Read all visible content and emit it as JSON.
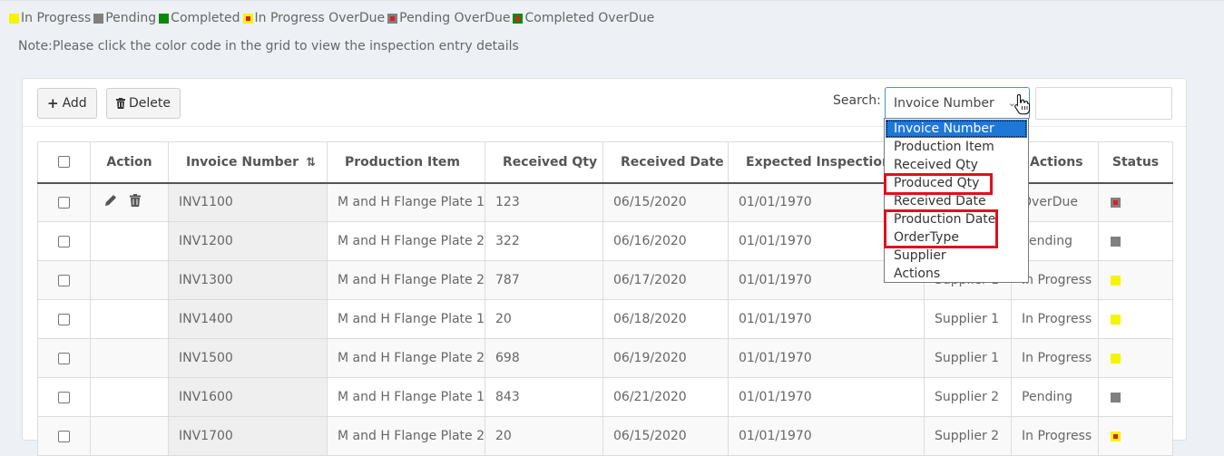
{
  "legend": [
    {
      "label": "In Progress",
      "color": "#f5f500",
      "overdue": false
    },
    {
      "label": "Pending",
      "color": "#808080",
      "overdue": false
    },
    {
      "label": "Completed",
      "color": "#0a8a0a",
      "overdue": false
    },
    {
      "label": "In Progress OverDue",
      "color": "#f5f500",
      "overdue": true
    },
    {
      "label": "Pending OverDue",
      "color": "#808080",
      "overdue": true
    },
    {
      "label": "Completed OverDue",
      "color": "#0a8a0a",
      "overdue": true
    }
  ],
  "note": "Note:Please click the color code in the grid to view the inspection entry details",
  "toolbar": {
    "add_label": "Add",
    "delete_label": "Delete",
    "search_label": "Search:",
    "search_select_value": "Invoice Number",
    "search_input_value": ""
  },
  "dropdown": {
    "options": [
      "Invoice Number",
      "Production Item",
      "Received Qty",
      "Produced Qty",
      "Received Date",
      "Production Date",
      "OrderType",
      "Supplier",
      "Actions"
    ],
    "selected_index": 0
  },
  "table": {
    "headers": {
      "action": "Action",
      "invoice": "Invoice Number",
      "item": "Production Item",
      "received_qty": "Received Qty",
      "received_date": "Received Date",
      "expected_date": "Expected Inspection D",
      "supplier": "",
      "actions": "Actions",
      "status": "Status"
    },
    "rows": [
      {
        "invoice": "INV1100",
        "item": "M and H Flange Plate 1",
        "qty": "123",
        "rdate": "06/15/2020",
        "edate": "01/01/1970",
        "supplier": "",
        "actions": "OverDue",
        "status_color": "#808080",
        "status_overdue": true,
        "has_actions": true
      },
      {
        "invoice": "INV1200",
        "item": "M and H Flange Plate 2",
        "qty": "322",
        "rdate": "06/16/2020",
        "edate": "01/01/1970",
        "supplier": "",
        "actions": "Pending",
        "status_color": "#808080",
        "status_overdue": false,
        "has_actions": false
      },
      {
        "invoice": "INV1300",
        "item": "M and H Flange Plate 2",
        "qty": "787",
        "rdate": "06/17/2020",
        "edate": "01/01/1970",
        "supplier": "Supplier 1",
        "actions": "In Progress",
        "status_color": "#f5f500",
        "status_overdue": false,
        "has_actions": false
      },
      {
        "invoice": "INV1400",
        "item": "M and H Flange Plate 1",
        "qty": "20",
        "rdate": "06/18/2020",
        "edate": "01/01/1970",
        "supplier": "Supplier 1",
        "actions": "In Progress",
        "status_color": "#f5f500",
        "status_overdue": false,
        "has_actions": false
      },
      {
        "invoice": "INV1500",
        "item": "M and H Flange Plate 2",
        "qty": "698",
        "rdate": "06/19/2020",
        "edate": "01/01/1970",
        "supplier": "Supplier 1",
        "actions": "In Progress",
        "status_color": "#f5f500",
        "status_overdue": false,
        "has_actions": false
      },
      {
        "invoice": "INV1600",
        "item": "M and H Flange Plate 1",
        "qty": "843",
        "rdate": "06/21/2020",
        "edate": "01/01/1970",
        "supplier": "Supplier 2",
        "actions": "Pending",
        "status_color": "#808080",
        "status_overdue": false,
        "has_actions": false
      },
      {
        "invoice": "INV1700",
        "item": "M and H Flange Plate 2",
        "qty": "20",
        "rdate": "06/15/2020",
        "edate": "01/01/1970",
        "supplier": "Supplier 2",
        "actions": "In Progress",
        "status_color": "#f5f500",
        "status_overdue": true,
        "has_actions": false
      }
    ]
  }
}
